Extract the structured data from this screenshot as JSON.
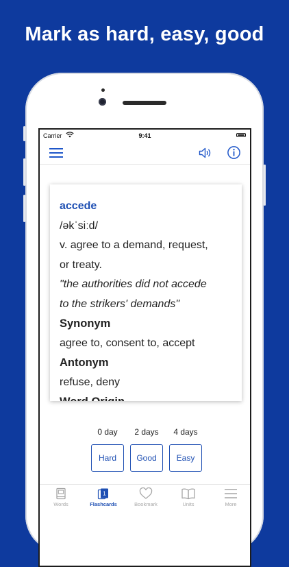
{
  "headline": "Mark as hard, easy, good",
  "status": {
    "carrier": "Carrier",
    "time": "9:41"
  },
  "card": {
    "word": "accede",
    "pronunciation": "/əkˈsiːd/",
    "definition_line1": "v. agree to a demand, request,",
    "definition_line2": "or treaty.",
    "example_line1": "\"the authorities did not accede",
    "example_line2": "to the strikers' demands\"",
    "synonym_title": "Synonym",
    "synonyms": "agree to, consent to, accept",
    "antonym_title": "Antonym",
    "antonyms": "refuse, deny",
    "origin_title": "Word Origin"
  },
  "intervals": [
    "0 day",
    "2 days",
    "4 days"
  ],
  "rating_buttons": [
    "Hard",
    "Good",
    "Easy"
  ],
  "tabs": [
    {
      "label": "Words",
      "icon": "book-icon"
    },
    {
      "label": "Flashcards",
      "icon": "flashcards-icon"
    },
    {
      "label": "Bookmark",
      "icon": "heart-icon"
    },
    {
      "label": "Units",
      "icon": "open-book-icon"
    },
    {
      "label": "More",
      "icon": "menu-icon"
    }
  ],
  "colors": {
    "background": "#0e3a9e",
    "accent": "#1e4fb3",
    "inactive_tab": "#a6a6a6"
  }
}
